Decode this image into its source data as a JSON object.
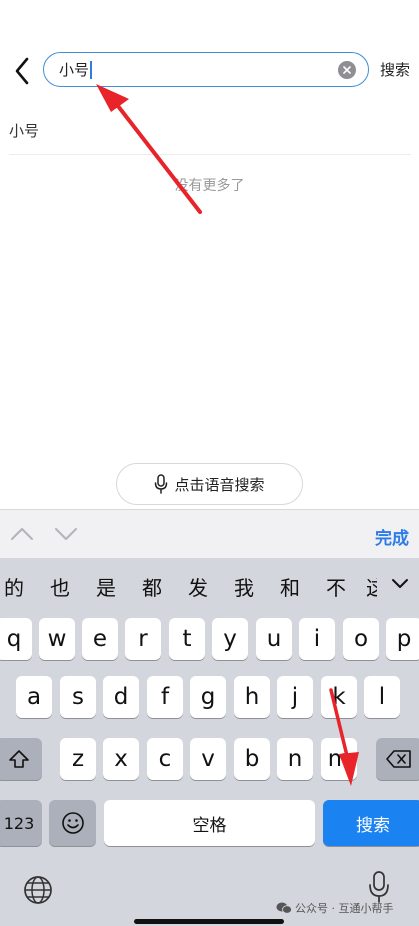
{
  "header": {
    "search_value": "小号",
    "search_action_label": "搜索"
  },
  "results": {
    "suggestion": "小号",
    "end_text": "没有更多了"
  },
  "voice_search_label": "点击语音搜索",
  "toolbar": {
    "done_label": "完成"
  },
  "keyboard": {
    "candidates": [
      "的",
      "也",
      "是",
      "都",
      "发",
      "我",
      "和",
      "不",
      "这"
    ],
    "row1": [
      "q",
      "w",
      "e",
      "r",
      "t",
      "y",
      "u",
      "i",
      "o",
      "p"
    ],
    "row2": [
      "a",
      "s",
      "d",
      "f",
      "g",
      "h",
      "j",
      "k",
      "l"
    ],
    "row3": [
      "z",
      "x",
      "c",
      "v",
      "b",
      "n",
      "m"
    ],
    "numbers_label": "123",
    "space_label": "空格",
    "search_label": "搜索"
  },
  "watermark": "公众号 · 互通小帮手",
  "colors": {
    "accent": "#2b7ce9",
    "search_key": "#1b82f1",
    "annotation_arrow": "#e8232a"
  }
}
